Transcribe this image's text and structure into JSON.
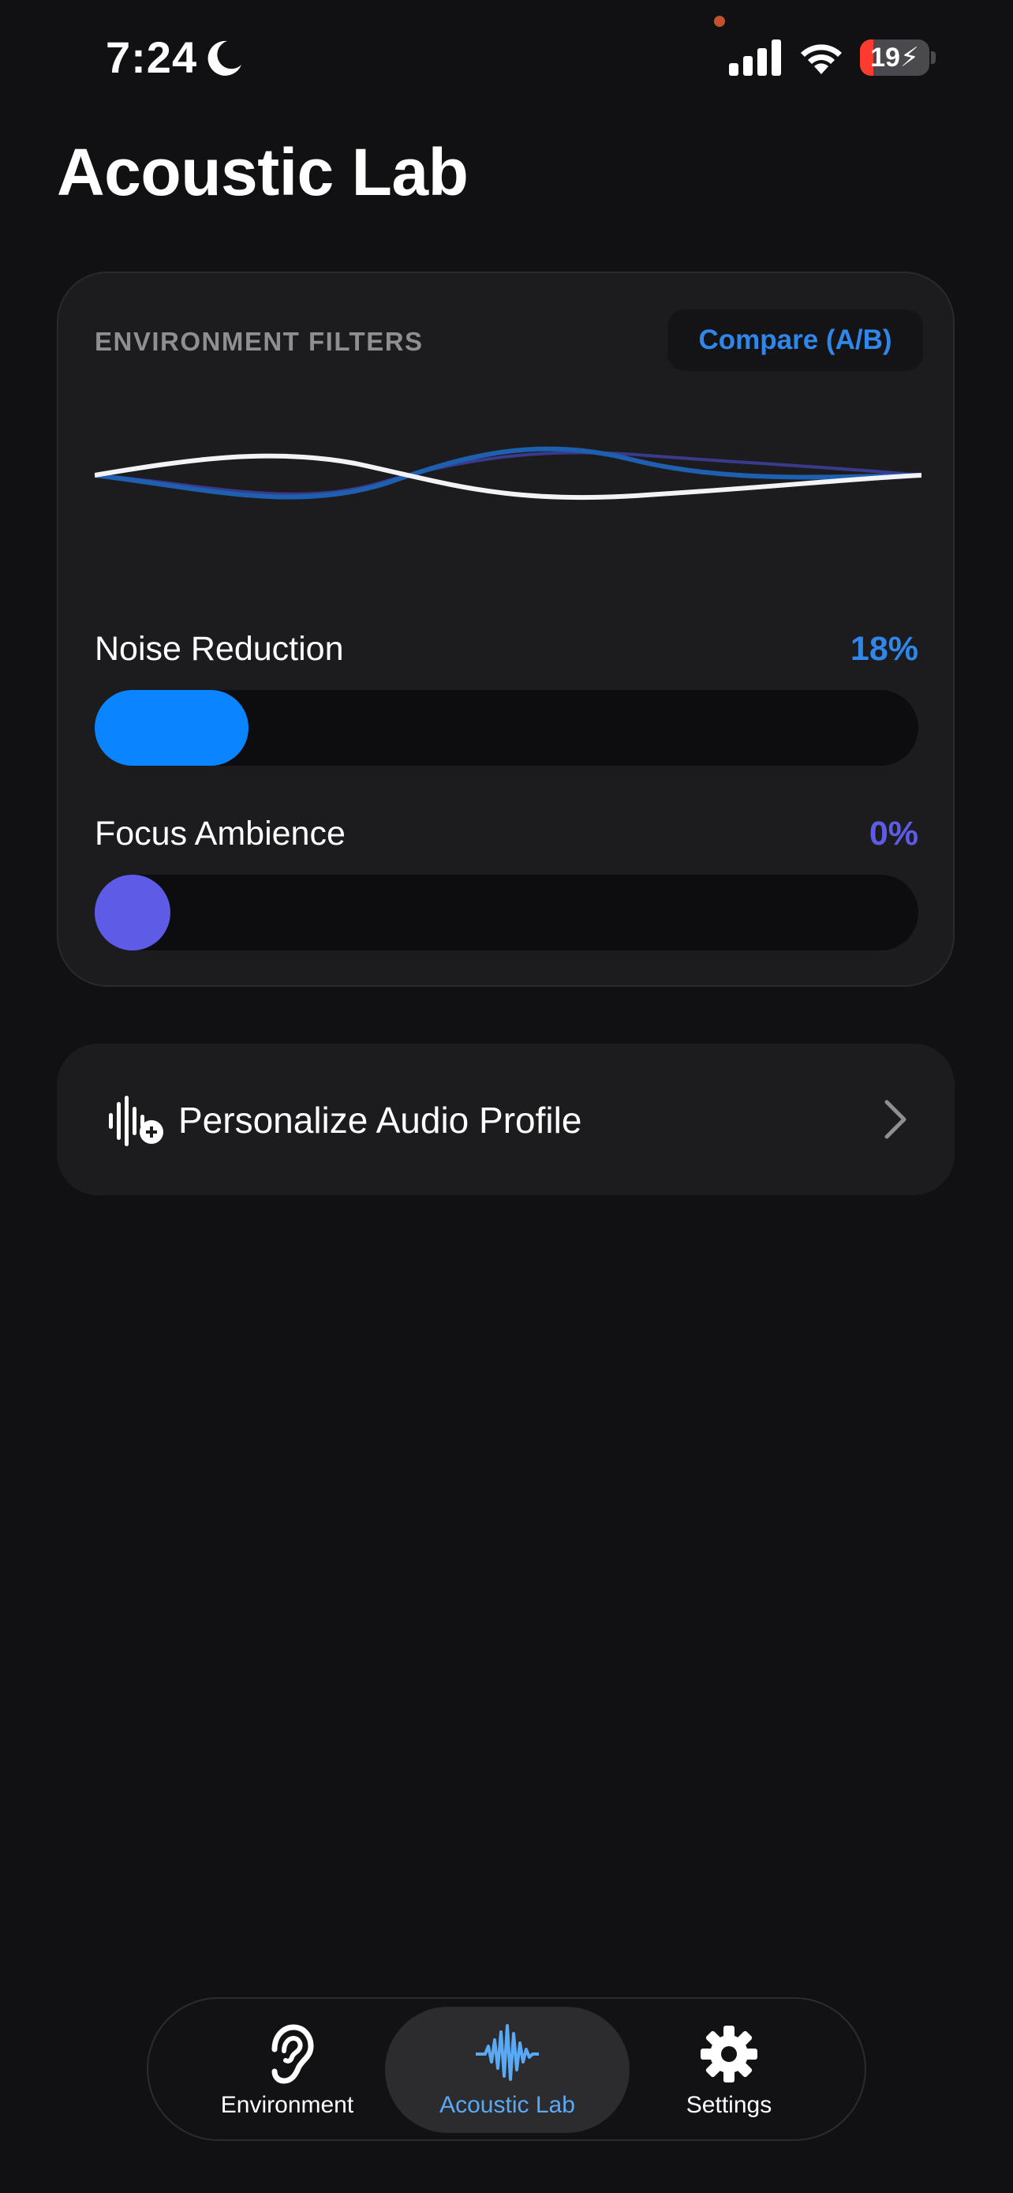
{
  "status_bar": {
    "time": "7:24",
    "battery_level": "19",
    "battery_charging": true
  },
  "page": {
    "title": "Acoustic Lab"
  },
  "filters_card": {
    "heading": "ENVIRONMENT FILTERS",
    "compare_label": "Compare (A/B)",
    "noise_reduction": {
      "label": "Noise Reduction",
      "value_text": "18%",
      "value": 0.18
    },
    "focus_ambience": {
      "label": "Focus Ambience",
      "value_text": "0%",
      "value": 0
    }
  },
  "personalize": {
    "label": "Personalize Audio Profile"
  },
  "tab_bar": {
    "tabs": [
      {
        "label": "Environment",
        "icon": "ear-icon",
        "selected": false
      },
      {
        "label": "Acoustic Lab",
        "icon": "waveform-icon",
        "selected": true
      },
      {
        "label": "Settings",
        "icon": "gear-icon",
        "selected": false
      }
    ]
  },
  "colors": {
    "accent_blue": "#0a84ff",
    "accent_indigo": "#5e5ce6",
    "background": "#111113",
    "card": "#1c1c1f"
  }
}
